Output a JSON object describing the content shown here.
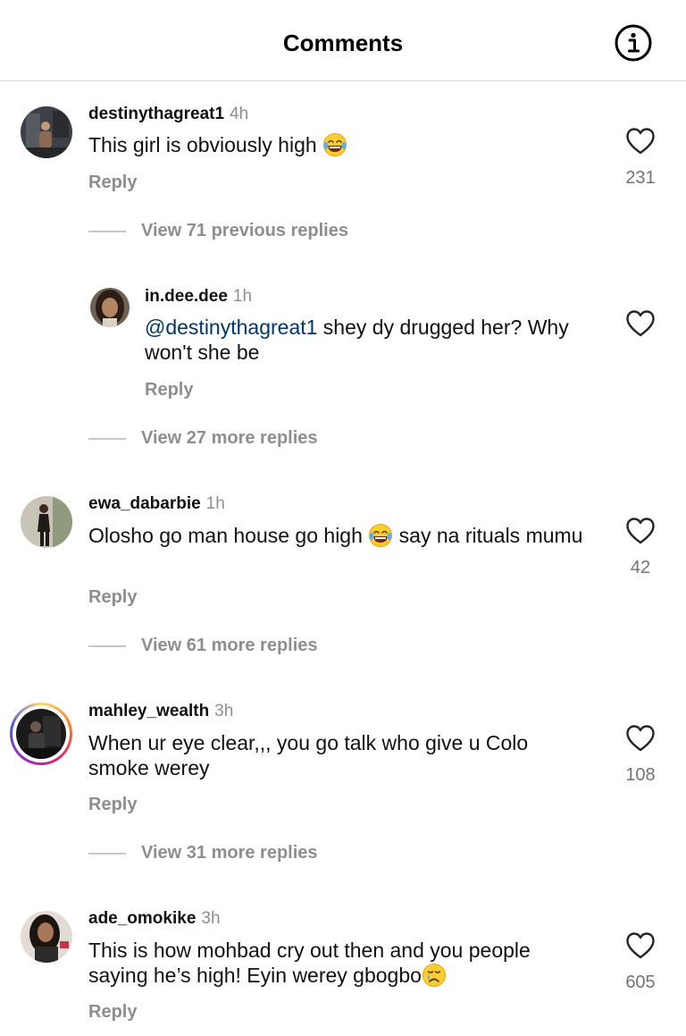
{
  "header": {
    "title": "Comments"
  },
  "comments": [
    {
      "username": "destinythagreat1",
      "time": "4h",
      "text": "This girl is obviously high",
      "reply_label": "Reply",
      "likes": "231",
      "view_replies": "View 71 previous replies"
    },
    {
      "username": "in.dee.dee",
      "time": "1h",
      "mention": "@destinythagreat1",
      "text": " shey dy drugged her? Why won't she be",
      "reply_label": "Reply",
      "view_replies": "View 27 more replies"
    },
    {
      "username": "ewa_dabarbie",
      "time": "1h",
      "text_before": "Olosho go man house go high ",
      "text_after": " say na rituals mumu",
      "reply_label": "Reply",
      "likes": "42",
      "view_replies": "View 61 more replies"
    },
    {
      "username": "mahley_wealth",
      "time": "3h",
      "text": "When ur eye clear,,, you go talk who give u Colo smoke werey",
      "reply_label": "Reply",
      "likes": "108",
      "view_replies": "View 31 more replies"
    },
    {
      "username": "ade_omokike",
      "time": "3h",
      "text": "This is how mohbad cry out then and you people saying he’s high! Eyin werey gbogbo",
      "reply_label": "Reply",
      "likes": "605"
    }
  ]
}
